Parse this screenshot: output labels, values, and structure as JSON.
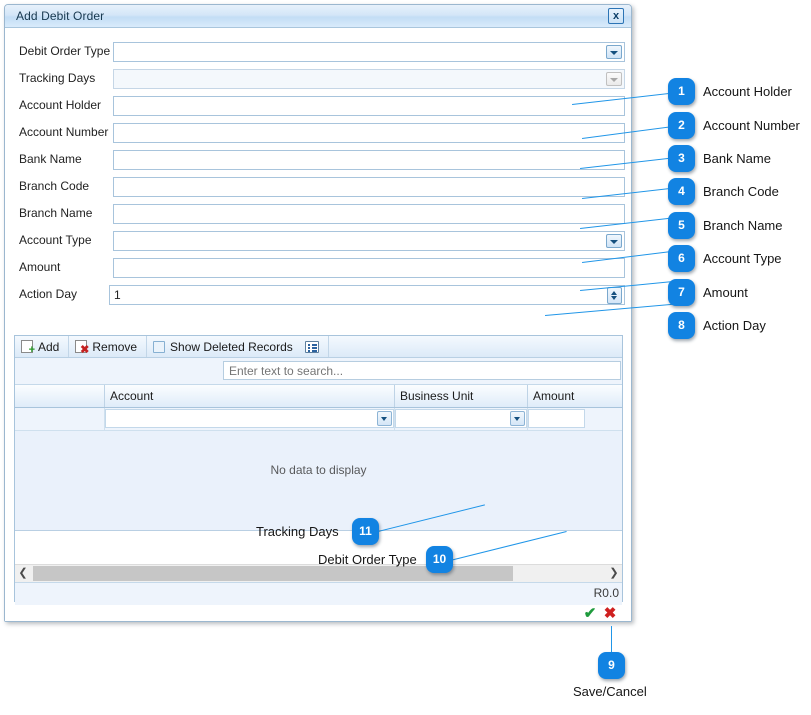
{
  "window": {
    "title": "Add Debit Order",
    "close_label": "x"
  },
  "form": {
    "fields": [
      {
        "label": "Debit Order Type",
        "value": "",
        "type": "combo",
        "disabled": false
      },
      {
        "label": "Tracking Days",
        "value": "",
        "type": "combo",
        "disabled": true
      },
      {
        "label": "Account Holder",
        "value": "",
        "type": "text",
        "disabled": false
      },
      {
        "label": "Account Number",
        "value": "",
        "type": "text",
        "disabled": false
      },
      {
        "label": "Bank Name",
        "value": "",
        "type": "text",
        "disabled": false
      },
      {
        "label": "Branch Code",
        "value": "",
        "type": "text",
        "disabled": false
      },
      {
        "label": "Branch Name",
        "value": "",
        "type": "text",
        "disabled": false
      },
      {
        "label": "Account Type",
        "value": "",
        "type": "combo",
        "disabled": false
      },
      {
        "label": "Amount",
        "value": "",
        "type": "text",
        "disabled": false
      },
      {
        "label": "Action Day",
        "value": "1",
        "type": "spin",
        "disabled": false
      }
    ]
  },
  "grid": {
    "toolbar": {
      "add_label": "Add",
      "remove_label": "Remove",
      "show_deleted_label": "Show Deleted Records",
      "show_deleted_checked": false
    },
    "search_placeholder": "Enter text to search...",
    "columns": [
      "",
      "Account",
      "Business Unit",
      "Amount"
    ],
    "new_row": {
      "account": "",
      "business_unit": "",
      "amount": ""
    },
    "empty_message": "No data to display",
    "footer_total": "R0.0"
  },
  "actions": {
    "save_label": "✔",
    "cancel_label": "✖"
  },
  "callouts": [
    {
      "n": "1",
      "text": "Account Holder"
    },
    {
      "n": "2",
      "text": "Account Number"
    },
    {
      "n": "3",
      "text": "Bank Name"
    },
    {
      "n": "4",
      "text": "Branch Code"
    },
    {
      "n": "5",
      "text": "Branch Name"
    },
    {
      "n": "6",
      "text": "Account Type"
    },
    {
      "n": "7",
      "text": "Amount"
    },
    {
      "n": "8",
      "text": "Action Day"
    },
    {
      "n": "9",
      "text": "Save/Cancel"
    },
    {
      "n": "10",
      "text": "Debit Order Type"
    },
    {
      "n": "11",
      "text": "Tracking Days"
    }
  ],
  "colors": {
    "badge": "#1283e2",
    "leader": "#2196e8",
    "title_text": "#17384f",
    "save": "#1f9b3d",
    "cancel": "#cf2020"
  }
}
